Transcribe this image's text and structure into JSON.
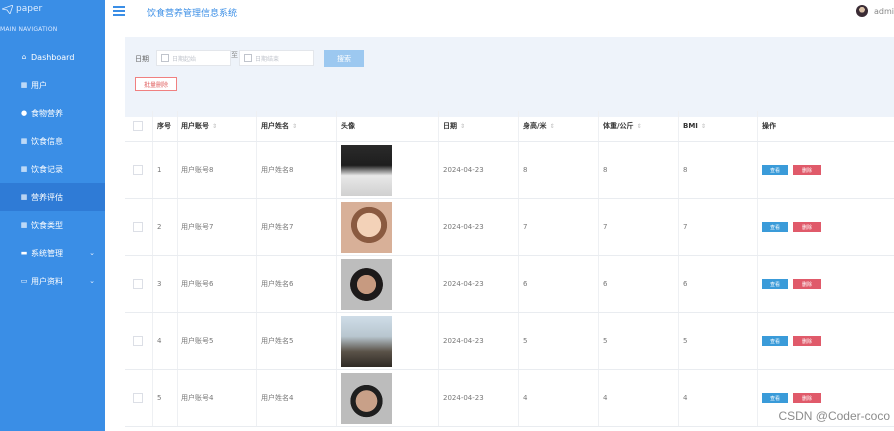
{
  "brand": {
    "name": "paper"
  },
  "sidebar": {
    "header": "MAIN NAVIGATION",
    "items": [
      {
        "label": "Dashboard",
        "icon": "home-icon"
      },
      {
        "label": "用户",
        "icon": "grid-icon"
      },
      {
        "label": "食物营养",
        "icon": "pin-icon"
      },
      {
        "label": "饮食信息",
        "icon": "grid-icon"
      },
      {
        "label": "饮食记录",
        "icon": "grid-icon"
      },
      {
        "label": "营养评估",
        "icon": "grid-icon",
        "active": true
      },
      {
        "label": "饮食类型",
        "icon": "grid-icon"
      },
      {
        "label": "系统管理",
        "icon": "monitor-icon",
        "expandable": true
      },
      {
        "label": "用户资料",
        "icon": "card-icon",
        "expandable": true
      }
    ]
  },
  "header": {
    "title": "饮食营养管理信息系统",
    "user": "admi"
  },
  "filter": {
    "date_label": "日期",
    "start_placeholder": "日期起始",
    "separator": "至",
    "end_placeholder": "日期结束",
    "search_label": "搜索",
    "bulk_delete_label": "批量删除"
  },
  "table": {
    "columns": [
      "序号",
      "用户账号",
      "用户姓名",
      "头像",
      "日期",
      "身高/米",
      "体重/公斤",
      "BMI",
      "操作"
    ],
    "view_label": "查看",
    "delete_label": "删除",
    "rows": [
      {
        "no": "1",
        "account": "用户账号8",
        "name": "用户姓名8",
        "date": "2024-04-23",
        "height": "8",
        "weight": "8",
        "bmi": "8"
      },
      {
        "no": "2",
        "account": "用户账号7",
        "name": "用户姓名7",
        "date": "2024-04-23",
        "height": "7",
        "weight": "7",
        "bmi": "7"
      },
      {
        "no": "3",
        "account": "用户账号6",
        "name": "用户姓名6",
        "date": "2024-04-23",
        "height": "6",
        "weight": "6",
        "bmi": "6"
      },
      {
        "no": "4",
        "account": "用户账号5",
        "name": "用户姓名5",
        "date": "2024-04-23",
        "height": "5",
        "weight": "5",
        "bmi": "5"
      },
      {
        "no": "5",
        "account": "用户账号4",
        "name": "用户姓名4",
        "date": "2024-04-23",
        "height": "4",
        "weight": "4",
        "bmi": "4"
      }
    ]
  },
  "watermark": "CSDN @Coder-coco",
  "colors": {
    "sidebar": "#3a8ee6",
    "accent": "#3a8ee6",
    "view": "#3a9bd9",
    "delete": "#e05a6a"
  }
}
